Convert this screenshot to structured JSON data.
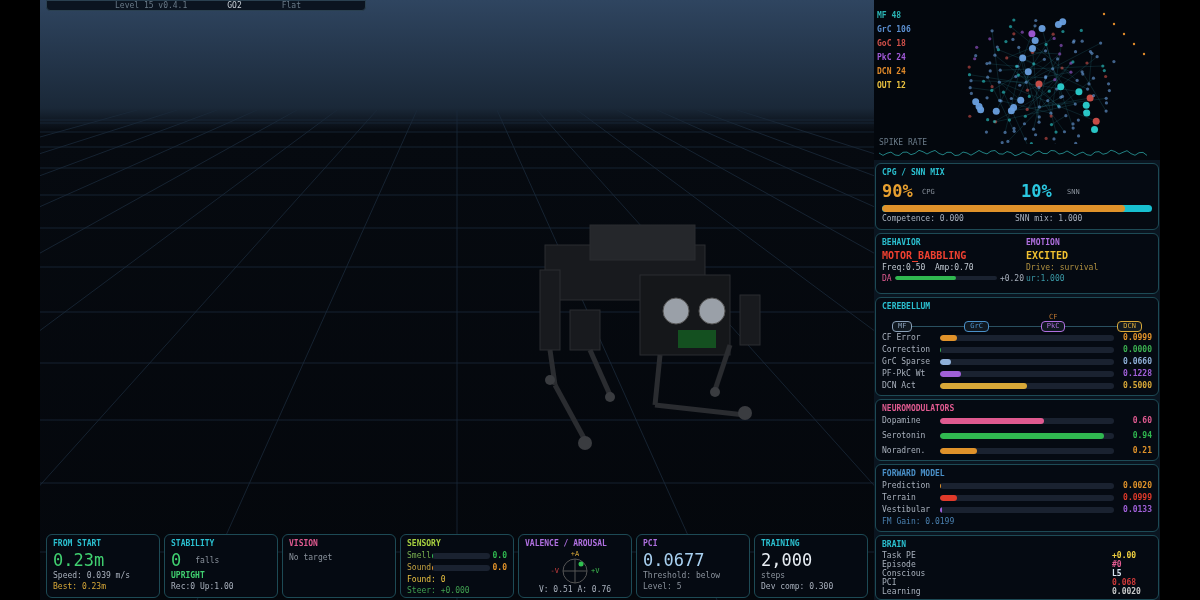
{
  "top_bar": {
    "level": "Level 15 v0.4.1",
    "gait": "GO2",
    "terrain": "Flat"
  },
  "network": {
    "legend": [
      {
        "label": "MF 48",
        "color": "#2bb5b5"
      },
      {
        "label": "GrC 106",
        "color": "#5b8fd0"
      },
      {
        "label": "GoC 18",
        "color": "#d0504a"
      },
      {
        "label": "PkC 24",
        "color": "#a25ad8"
      },
      {
        "label": "DCN 24",
        "color": "#e08a2a"
      },
      {
        "label": "OUT 12",
        "color": "#e8c040"
      }
    ],
    "spike_label": "SPIKE RATE"
  },
  "cpg_mix": {
    "title": "CPG / SNN MIX",
    "cpg_value": "90%",
    "cpg_label": "CPG",
    "snn_value": "10%",
    "snn_label": "SNN",
    "level": 0.9,
    "competence": "Competence: 0.000",
    "snn_mix": "SNN mix: 1.000"
  },
  "behavior": {
    "title": "BEHAVIOR",
    "state": "MOTOR_BABBLING",
    "params": "Freq:0.50  Amp:0.70",
    "da_label": "DA",
    "level": 0.6,
    "da_value": "+0.20"
  },
  "emotion": {
    "title": "EMOTION",
    "state": "EXCITED",
    "drive": "Drive: survival",
    "extra": "ur:1.000"
  },
  "cerebellum": {
    "title": "CEREBELLUM",
    "cf_label": "CF",
    "nodes": [
      {
        "label": "MF",
        "color": "#8aa0b8"
      },
      {
        "label": "GrC",
        "color": "#4a90c8"
      },
      {
        "label": "PkC",
        "color": "#b070e0"
      },
      {
        "label": "DCN",
        "color": "#d8a838"
      }
    ],
    "rows": [
      {
        "label": "CF Error",
        "level": 0.1,
        "value": "0.0999",
        "color": "#e0922a"
      },
      {
        "label": "Correction",
        "level": 0,
        "value": "0.0000",
        "color": "#3cb050"
      },
      {
        "label": "GrC Sparse",
        "level": 0.066,
        "value": "0.0660",
        "color": "#8fb0d8"
      },
      {
        "label": "PF-PkC Wt",
        "level": 0.123,
        "value": "0.1228",
        "color": "#a060d8"
      },
      {
        "label": "DCN Act",
        "level": 0.5,
        "value": "0.5000",
        "color": "#d8a838"
      }
    ]
  },
  "neuromodulators": {
    "title": "NEUROMODULATORS",
    "rows": [
      {
        "label": "Dopamine",
        "level": 0.6,
        "value": "0.60",
        "color": "#e05a90"
      },
      {
        "label": "Serotonin",
        "level": 0.94,
        "value": "0.94",
        "color": "#30b850"
      },
      {
        "label": "Noradren.",
        "level": 0.21,
        "value": "0.21",
        "color": "#e0922a"
      }
    ]
  },
  "forward_model": {
    "title": "FORWARD MODEL",
    "rows": [
      {
        "label": "Prediction",
        "level": 0.002,
        "value": "0.0020",
        "color": "#e0922a"
      },
      {
        "label": "Terrain",
        "level": 0.1,
        "value": "0.0999",
        "color": "#e03a2a"
      },
      {
        "label": "Vestibular",
        "level": 0.013,
        "value": "0.0133",
        "color": "#a060d8"
      }
    ],
    "gain": "FM Gain: 0.0199"
  },
  "brain": {
    "title": "BRAIN",
    "rows": [
      {
        "label": "Task PE",
        "value": "+0.00",
        "color": "#f0d040"
      },
      {
        "label": "Episode",
        "value": "#0",
        "color": "#e05a90"
      },
      {
        "label": "Conscious",
        "value": "L5",
        "color": "#d8e4f0"
      },
      {
        "label": "PCI",
        "value": "0.068",
        "color": "#d03a3a"
      },
      {
        "label": "Learning",
        "value": "0.0020",
        "color": "#c8c8c8"
      }
    ]
  },
  "bottom_panels": [
    {
      "kind": "distance",
      "title": "FROM START",
      "color": "#2bc0d0",
      "value": "0.23m",
      "lines": [
        "Speed: 0.039 m/s",
        "Best: 0.23m"
      ]
    },
    {
      "kind": "stability",
      "title": "STABILITY",
      "color": "#2bc0d0",
      "value": "0",
      "unit": "falls",
      "status": "UPRIGHT",
      "lines": [
        "Rec:0  Up:1.00"
      ]
    },
    {
      "kind": "vision",
      "title": "VISION",
      "color": "#e05a90",
      "lines": [
        "No target"
      ]
    },
    {
      "kind": "sensory",
      "title": "SENSORY",
      "color": "#a8d040",
      "bars": [
        {
          "label": "Smell",
          "level": 0,
          "value": "0.0",
          "color": "#30b850"
        },
        {
          "label": "Sound",
          "level": 0,
          "value": "0.0",
          "color": "#e0922a"
        }
      ],
      "lines": [
        "Found: 0",
        "Steer: +0.000"
      ]
    },
    {
      "kind": "valence",
      "title": "VALENCE / AROUSAL",
      "color": "#b070e0",
      "axes": [
        "+A",
        "-V",
        "+V"
      ],
      "lines": [
        "V: 0.51  A: 0.76"
      ]
    },
    {
      "kind": "pci",
      "title": "PCI",
      "color": "#b070e0",
      "value": "0.0677",
      "lines": [
        "Threshold: below",
        "Level: 5"
      ]
    },
    {
      "kind": "training",
      "title": "TRAINING",
      "color": "#2bc0d0",
      "value": "2,000",
      "unit": "steps",
      "lines": [
        "Dev comp: 0.300"
      ]
    }
  ]
}
